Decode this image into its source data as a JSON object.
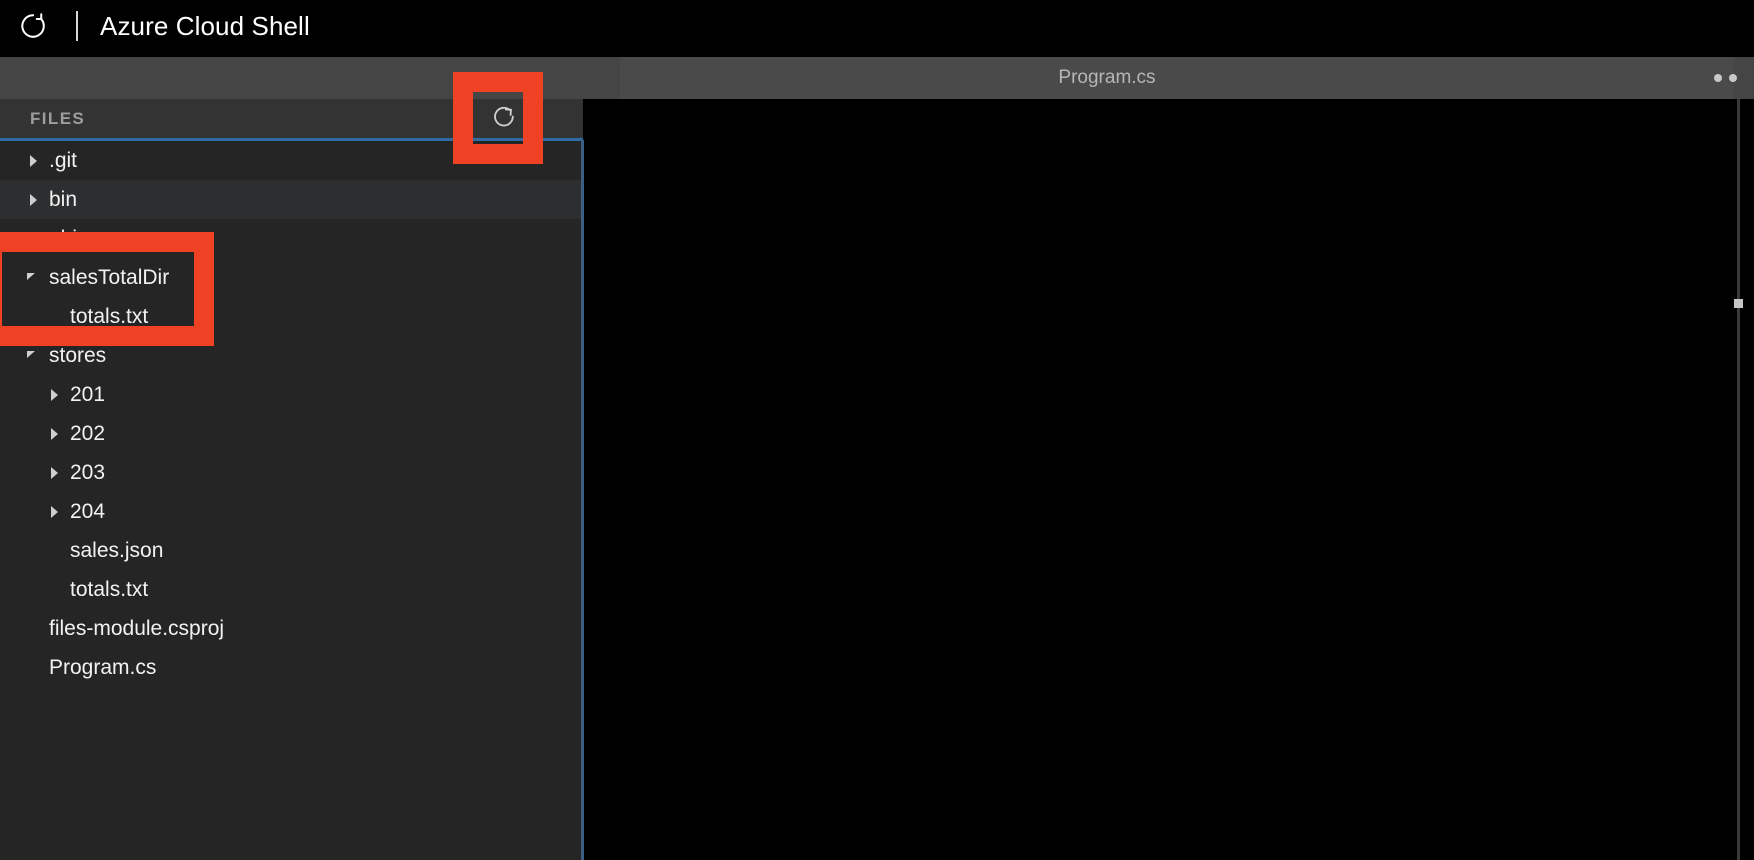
{
  "titlebar": {
    "restart_icon": "restart-circular-arrow-icon",
    "separator": "|",
    "title": "Azure Cloud Shell"
  },
  "tabstrip": {
    "active_tab": "Program.cs",
    "more_icon": "ellipsis-more-icon"
  },
  "sidebar": {
    "header_title": "FILES",
    "refresh_icon": "refresh-icon",
    "accent_color": "#2f6ca3",
    "tree": [
      {
        "label": ".git",
        "depth": 0,
        "type": "folder",
        "state": "collapsed",
        "highlighted": false
      },
      {
        "label": "bin",
        "depth": 0,
        "type": "folder",
        "state": "collapsed",
        "highlighted": true
      },
      {
        "label": "obj",
        "depth": 0,
        "type": "folder",
        "state": "collapsed",
        "highlighted": false
      },
      {
        "label": "salesTotalDir",
        "depth": 0,
        "type": "folder",
        "state": "expanded",
        "highlighted": false
      },
      {
        "label": "totals.txt",
        "depth": 1,
        "type": "file",
        "state": "none",
        "highlighted": false
      },
      {
        "label": "stores",
        "depth": 0,
        "type": "folder",
        "state": "expanded",
        "highlighted": false
      },
      {
        "label": "201",
        "depth": 1,
        "type": "folder",
        "state": "collapsed",
        "highlighted": false
      },
      {
        "label": "202",
        "depth": 1,
        "type": "folder",
        "state": "collapsed",
        "highlighted": false
      },
      {
        "label": "203",
        "depth": 1,
        "type": "folder",
        "state": "collapsed",
        "highlighted": false
      },
      {
        "label": "204",
        "depth": 1,
        "type": "folder",
        "state": "collapsed",
        "highlighted": false
      },
      {
        "label": "sales.json",
        "depth": 1,
        "type": "file",
        "state": "none",
        "highlighted": false
      },
      {
        "label": "totals.txt",
        "depth": 1,
        "type": "file",
        "state": "none",
        "highlighted": false
      },
      {
        "label": "files-module.csproj",
        "depth": 0,
        "type": "file",
        "state": "none",
        "highlighted": false
      },
      {
        "label": "Program.cs",
        "depth": 0,
        "type": "file",
        "state": "none",
        "highlighted": false
      }
    ]
  },
  "editor": {
    "content": "",
    "background": "#000000"
  },
  "annotations": {
    "color": "#ef4123",
    "boxes": [
      {
        "name": "refresh-button-highlight",
        "target": "refresh-icon"
      },
      {
        "name": "salestotaldir-highlight",
        "target": "salesTotalDir"
      }
    ]
  }
}
